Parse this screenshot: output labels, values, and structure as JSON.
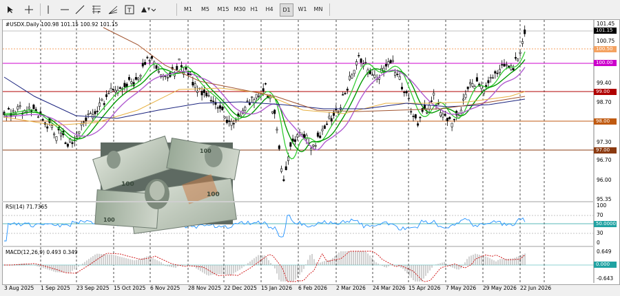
{
  "toolbar": {
    "periods": [
      "M1",
      "M5",
      "M15",
      "M30",
      "H1",
      "H4",
      "D1",
      "W1",
      "MN"
    ],
    "active_period": "D1",
    "tools": [
      "cursor-icon",
      "crosshair-icon",
      "vertical-line-icon",
      "horizontal-line-icon",
      "trendline-icon",
      "fibonacci-icon",
      "fib-fan-icon",
      "text-icon",
      "shapes-icon"
    ]
  },
  "main": {
    "header": "#USDX.Daily  100.98 101.15 100.92 101.15",
    "price_ticks": [
      "101.45",
      "100.75",
      "100.00",
      "99.40",
      "98.70",
      "98.00",
      "97.30",
      "96.70",
      "96.00",
      "95.35"
    ],
    "level_tags": [
      {
        "text": "101.15",
        "bg": "#000000",
        "fg": "#ffffff"
      },
      {
        "text": "100.50",
        "bg": "#f4a261",
        "fg": "#ffffff"
      },
      {
        "text": "100.00",
        "bg": "#cc00cc",
        "fg": "#ffffff"
      },
      {
        "text": "99.00",
        "bg": "#b00000",
        "fg": "#ffffff"
      },
      {
        "text": "98.00",
        "bg": "#c05a10",
        "fg": "#ffffff"
      },
      {
        "text": "97.00",
        "bg": "#8b3a10",
        "fg": "#ffffff"
      }
    ]
  },
  "rsi": {
    "header": "RSI(14) 71.7365",
    "ticks": [
      "100",
      "70",
      "30",
      "0"
    ],
    "tag": "50.0000"
  },
  "macd": {
    "header": "MACD(12,26,9) 0.493 0.349",
    "ticks": [
      "0.649",
      "-0.643"
    ],
    "tag": "0.000"
  },
  "dates": [
    "3 Aug 2025",
    "1 Sep 2025",
    "23 Sep 2025",
    "15 Oct 2025",
    "6 Nov 2025",
    "28 Nov 2025",
    "22 Dec 2025",
    "15 Jan 2026",
    "6 Feb 2026",
    "2 Mar 2026",
    "24 Mar 2026",
    "15 Apr 2026",
    "7 May 2026",
    "29 May 2026",
    "22 Jun 2026"
  ],
  "colors": {
    "candle": "#000000",
    "ma_green_light": "#33cc33",
    "ma_green_dark": "#009900",
    "ma_purple": "#b05bd0",
    "ma_orange": "#e8b040",
    "ma_navy": "#1a237e",
    "ma_brown": "#a0522d",
    "rsi_line": "#1e90ff",
    "macd_hist": "#a0a0a0",
    "macd_signal": "#cc0000"
  }
}
